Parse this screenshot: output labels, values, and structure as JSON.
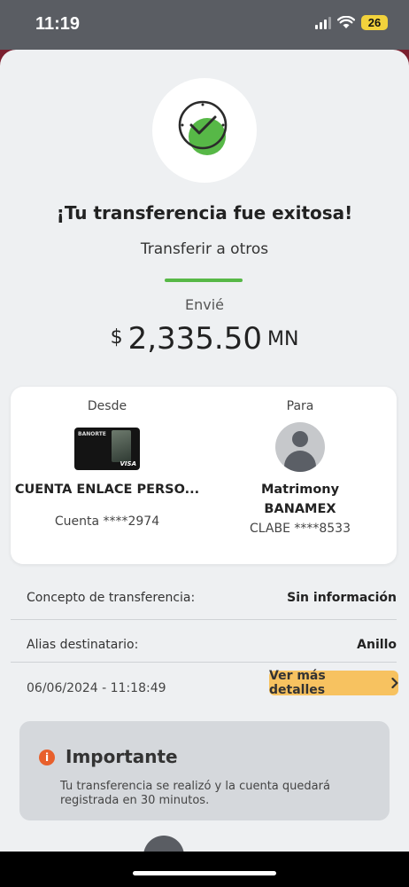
{
  "status": {
    "time": "11:19",
    "battery": "26"
  },
  "header": {
    "title": "¡Tu transferencia fue exitosa!",
    "subtitle": "Transferir a otros"
  },
  "amount": {
    "label": "Envié",
    "symbol": "$",
    "value": "2,335.50",
    "currency": "MN"
  },
  "from": {
    "heading": "Desde",
    "account_name": "CUENTA ENLACE PERSO...",
    "account": "Cuenta ****2974",
    "card_brand": "BANORTE",
    "card_network": "VISA"
  },
  "to": {
    "heading": "Para",
    "name": "Matrimony",
    "bank": "BANAMEX",
    "account": "CLABE ****8533"
  },
  "details": {
    "concept_label": "Concepto de transferencia:",
    "concept_value": "Sin información",
    "alias_label": "Alias destinatario:",
    "alias_value": "Anillo",
    "datetime": "06/06/2024 - 11:18:49",
    "more_button": "Ver más detalles"
  },
  "notice": {
    "title": "Importante",
    "text": "Tu transferencia se realizó y la cuenta quedará registrada en 30 minutos."
  },
  "colors": {
    "accent_green": "#57b847",
    "button_orange": "#f7c260",
    "info_orange": "#e8602c"
  }
}
